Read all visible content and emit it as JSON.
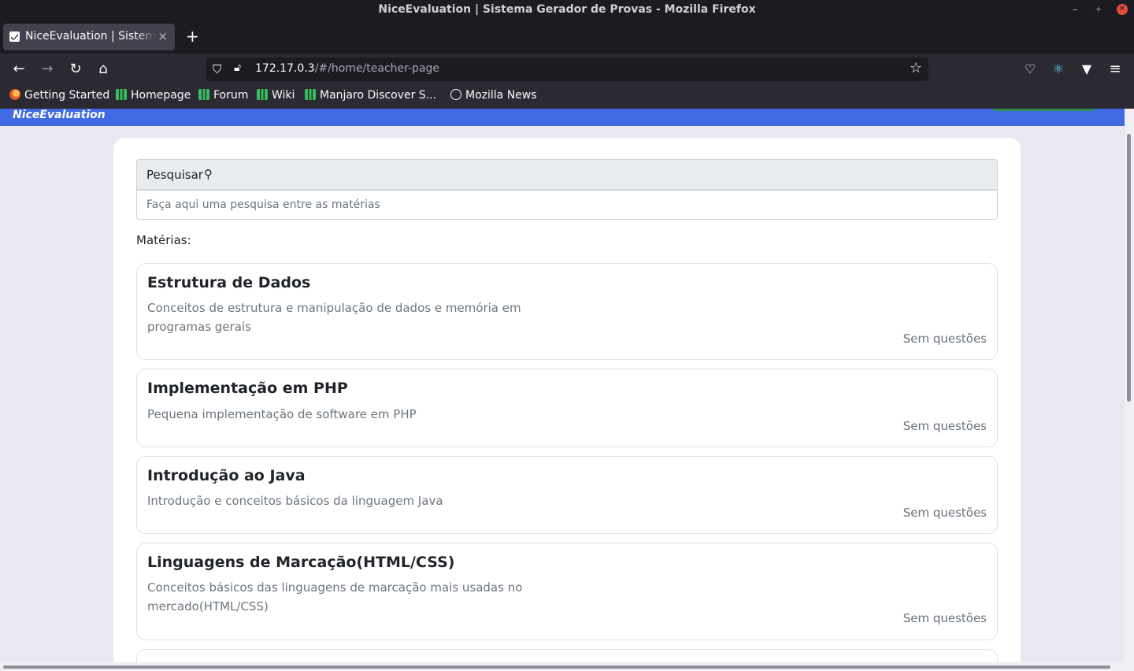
{
  "window": {
    "title": "NiceEvaluation | Sistema Gerador de Provas - Mozilla Firefox"
  },
  "tab": {
    "label": "NiceEvaluation | Sistema Gerador de Provas",
    "close": "×",
    "new": "+"
  },
  "nav": {
    "back": "←",
    "forward": "→",
    "reload": "↻",
    "home": "⌂",
    "url_host": "172.17.0.3",
    "url_path": "/#/home/teacher-page",
    "star": "☆"
  },
  "toolbar": {
    "menu": "≡",
    "react": "⚛",
    "ext": "▼",
    "pocket": "♡"
  },
  "bookmarks": [
    {
      "label": "Getting Started",
      "icon": "firefox-icon"
    },
    {
      "label": "Homepage",
      "icon": "manjaro-icon"
    },
    {
      "label": "Forum",
      "icon": "manjaro-icon"
    },
    {
      "label": "Wiki",
      "icon": "manjaro-icon"
    },
    {
      "label": "Manjaro Discover S...",
      "icon": "manjaro-icon"
    },
    {
      "label": "Mozilla News",
      "icon": "globe-icon"
    }
  ],
  "app": {
    "brand": "NiceEvaluation",
    "search": {
      "label": "Pesquisar",
      "placeholder": "Faça aqui uma pesquisa entre as matérias"
    },
    "materias_label": "Matérias:",
    "subjects": [
      {
        "title": "Estrutura de Dados",
        "description": "Conceitos de estrutura e manipulação de dados e memória em programas gerais",
        "count": "Sem questões"
      },
      {
        "title": "Implementação em PHP",
        "description": "Pequena implementação de software em PHP",
        "count": "Sem questões"
      },
      {
        "title": "Introdução ao Java",
        "description": "Introdução e conceitos básicos da linguagem Java",
        "count": "Sem questões"
      },
      {
        "title": "Linguagens de Marcação(HTML/CSS)",
        "description": "Conceitos básicos das linguagens de marcação mais usadas no mercado(HTML/CSS)",
        "count": "Sem questões"
      }
    ]
  },
  "colors": {
    "appbar": "#4169e1",
    "page_bg": "#e8e8f3"
  }
}
